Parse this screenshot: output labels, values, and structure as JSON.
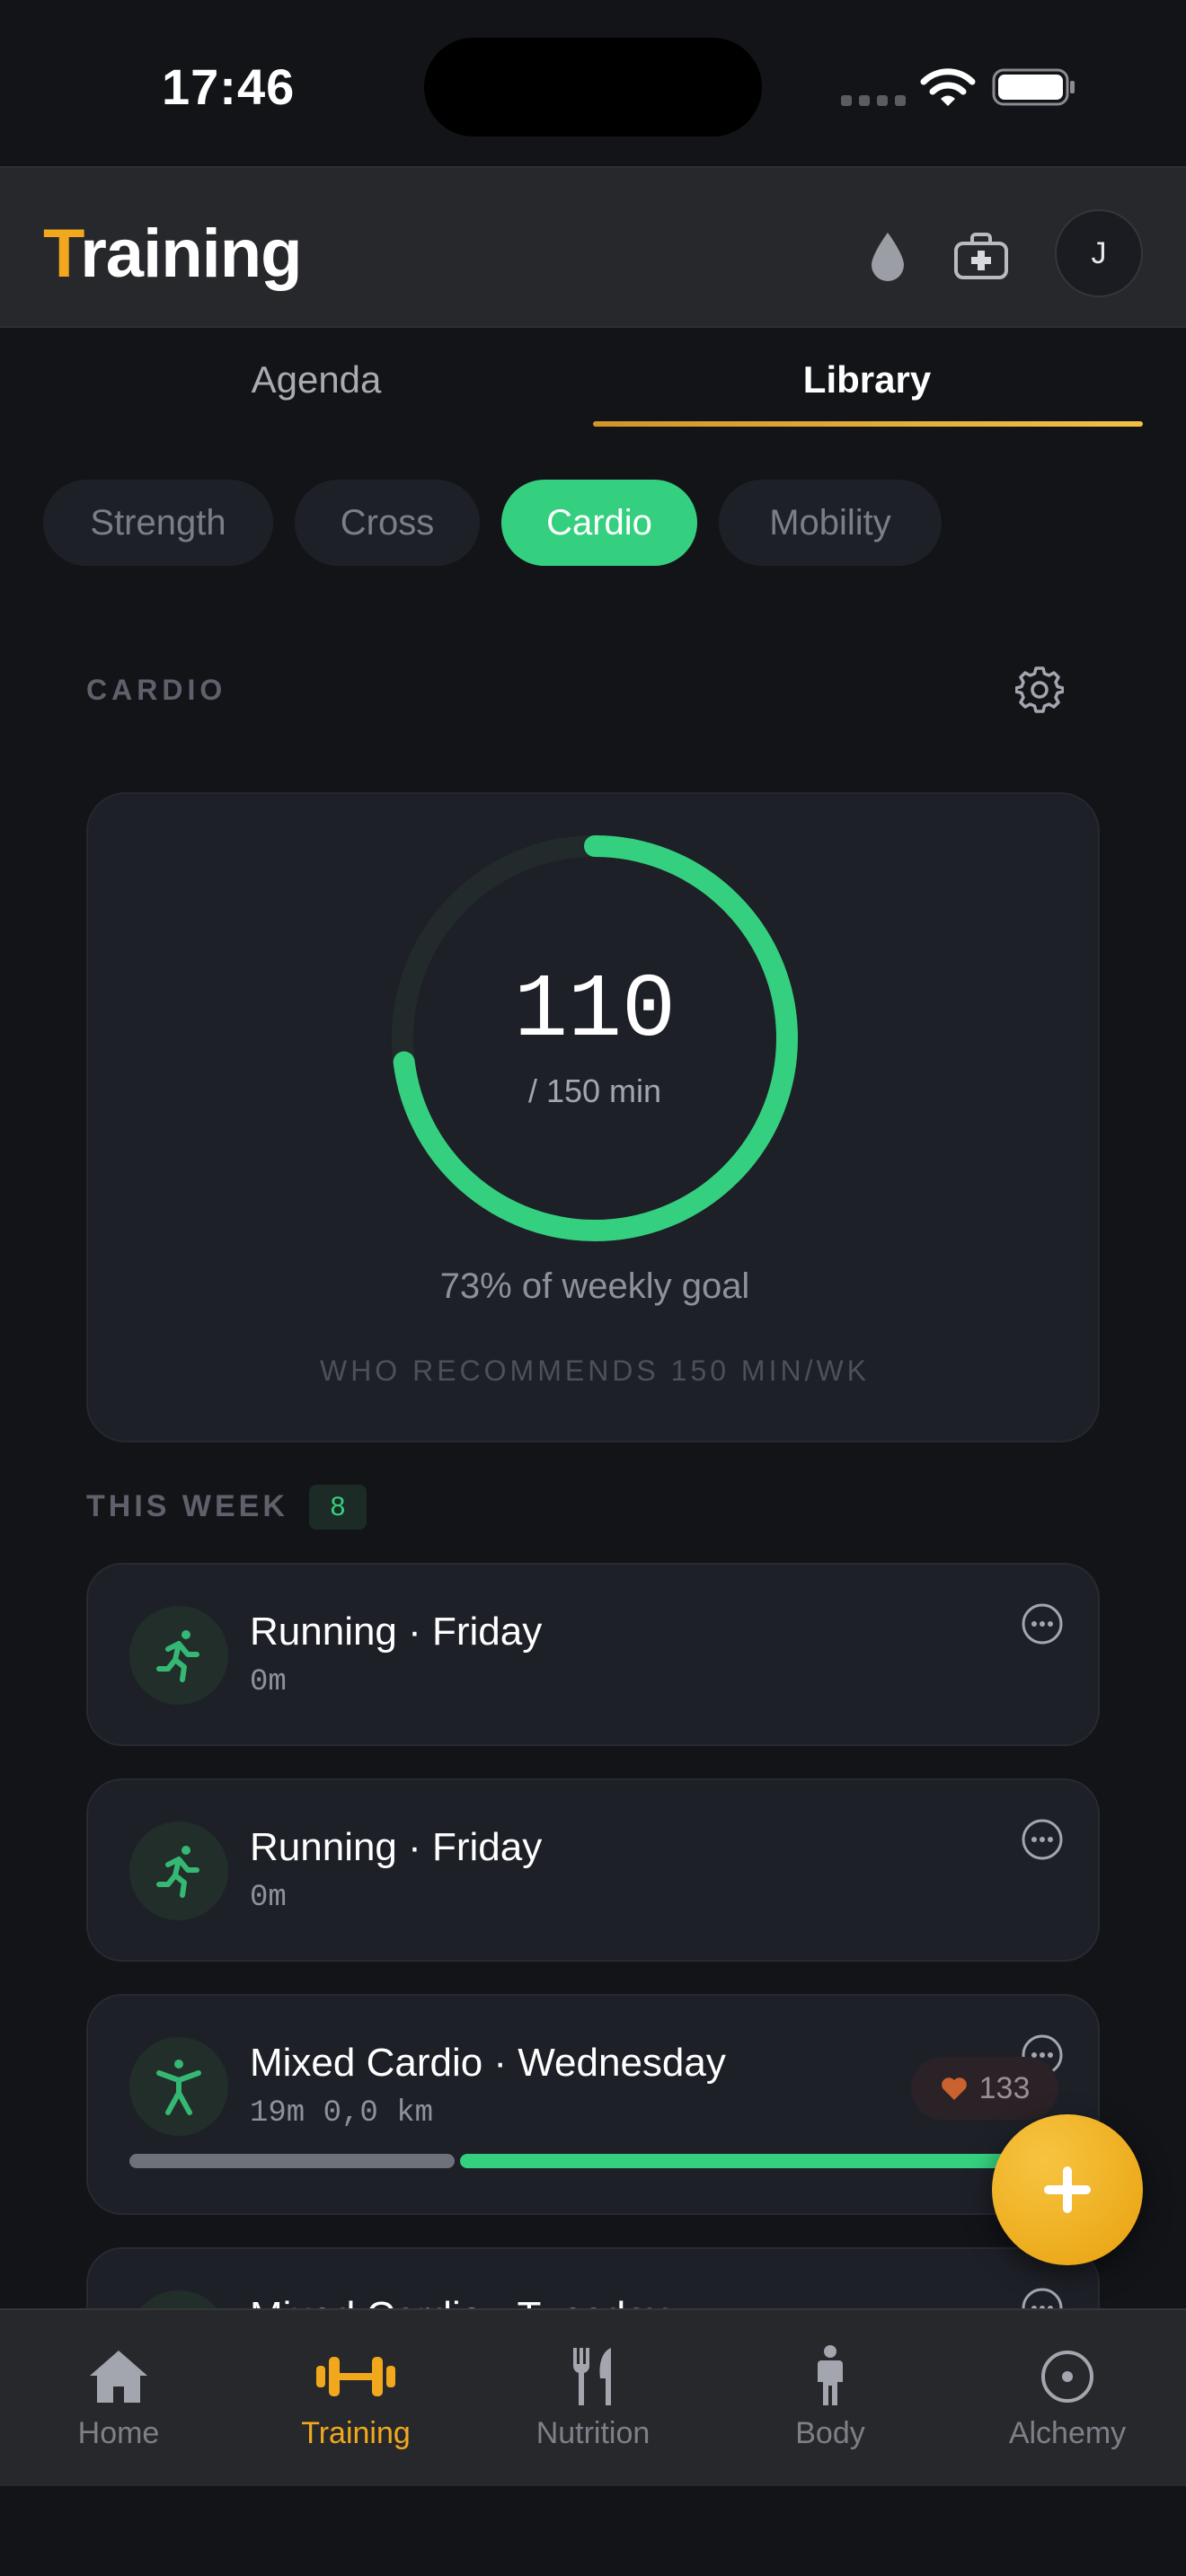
{
  "status_bar": {
    "time": "17:46"
  },
  "header": {
    "title_first_letter": "T",
    "title_rest": "raining",
    "avatar_initial": "J"
  },
  "tabs": [
    {
      "label": "Agenda",
      "active": false
    },
    {
      "label": "Library",
      "active": true
    }
  ],
  "filters": [
    {
      "label": "Strength",
      "active": false
    },
    {
      "label": "Cross",
      "active": false
    },
    {
      "label": "Cardio",
      "active": true
    },
    {
      "label": "Mobility",
      "active": false
    }
  ],
  "section": {
    "label": "CARDIO"
  },
  "goal": {
    "value": "110",
    "target_text": "/ 150 min",
    "progress_fraction": 0.73,
    "percent_text": "73% of weekly goal",
    "note": "WHO RECOMMENDS 150 MIN/WK"
  },
  "week": {
    "label": "THIS WEEK",
    "count": "8",
    "sessions": [
      {
        "title": "Running · Friday",
        "meta": "0m",
        "icon": "running-icon"
      },
      {
        "title": "Running · Friday",
        "meta": "0m",
        "icon": "running-icon"
      },
      {
        "title": "Mixed Cardio · Wednesday",
        "meta": "19m 0,0 km",
        "icon": "mixed-cardio-icon",
        "heart_rate": "133",
        "progress": [
          0.35,
          0.65
        ]
      },
      {
        "title": "Mixed Cardio · Tuesday",
        "meta": "",
        "icon": "mixed-cardio-icon"
      }
    ]
  },
  "nav": [
    {
      "label": "Home",
      "icon": "home-icon",
      "active": false
    },
    {
      "label": "Training",
      "icon": "dumbbell-icon",
      "active": true
    },
    {
      "label": "Nutrition",
      "icon": "fork-knife-icon",
      "active": false
    },
    {
      "label": "Body",
      "icon": "person-icon",
      "active": false
    },
    {
      "label": "Alchemy",
      "icon": "target-icon",
      "active": false
    }
  ],
  "colors": {
    "accent": "#f2a81d",
    "cardio_green": "#35d07f",
    "background": "#131418",
    "card": "#1e2028"
  }
}
